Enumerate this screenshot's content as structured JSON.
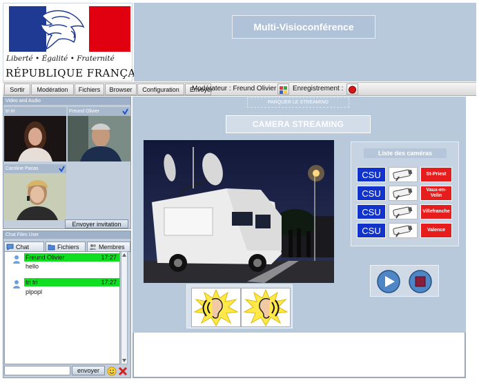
{
  "logo": {
    "motto": "Liberté • Égalité • Fraternité",
    "republic": "RÉPUBLIQUE FRANÇAISE"
  },
  "app": {
    "title": "Multi-Visioconférence"
  },
  "menu": {
    "items": [
      "Sortir",
      "Modération",
      "Fichiers",
      "Browser",
      "Configuration",
      "Envoyer"
    ],
    "moderator_label": "Modérateur : Freund Olivier",
    "recording_label": "Enregistrement :"
  },
  "video_panel": {
    "title": "Video and Audio",
    "participants": [
      {
        "name": "tri tri"
      },
      {
        "name": "Freund Olivier"
      },
      {
        "name": "Caroline Pacas"
      }
    ],
    "invite_button": "Envoyer invitation"
  },
  "chat_panel": {
    "title": "Chat Files User",
    "tabs": [
      "Chat",
      "Fichiers",
      "Membres"
    ],
    "messages": [
      {
        "author": "Freund Olivier",
        "time": "17:27",
        "text": "hello"
      },
      {
        "author": "tri tri",
        "time": "17:27",
        "text": "plpopl"
      }
    ],
    "input_value": "",
    "send_button": "envoyer"
  },
  "streaming": {
    "park_label": "PARQUER LE STREAMING",
    "camera_streaming_label": "CAMERA STREAMING"
  },
  "camera_list": {
    "title": "Liste des caméras",
    "cameras": [
      {
        "badge": "CSU",
        "location": "St-Priest"
      },
      {
        "badge": "CSU",
        "location": "Vaux-en-Velin"
      },
      {
        "badge": "CSU",
        "location": "Villefranche"
      },
      {
        "badge": "CSU",
        "location": "Valence"
      }
    ]
  },
  "colors": {
    "panel_bg": "#b9c9dc",
    "csu_blue": "#1133cc",
    "location_red": "#e51d1d",
    "chat_green": "#11dd22"
  }
}
